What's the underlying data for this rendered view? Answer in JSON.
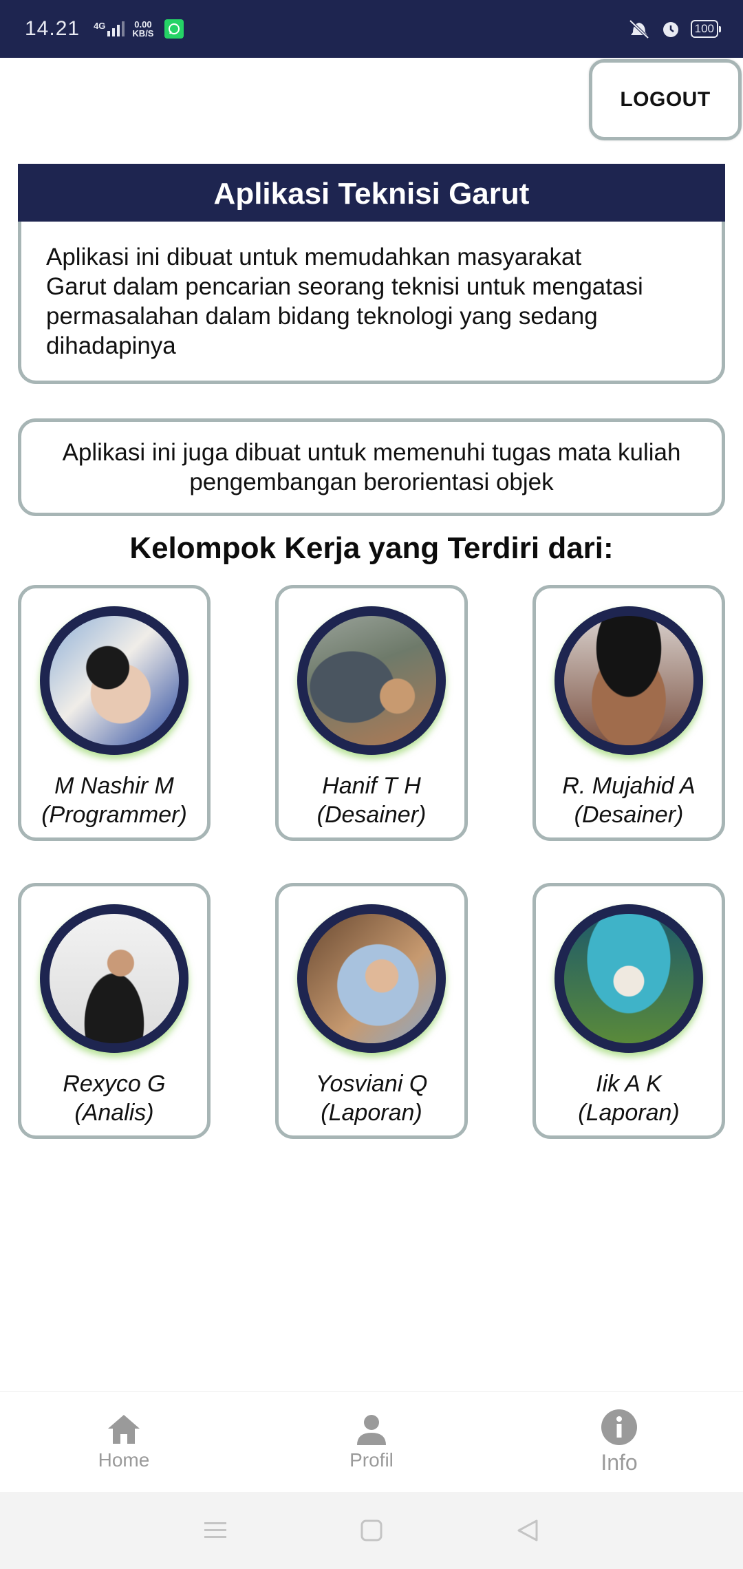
{
  "status_bar": {
    "time": "14.21",
    "network": "4G",
    "speed_value": "0.00",
    "speed_unit": "KB/S",
    "battery": "100"
  },
  "header": {
    "logout_label": "LOGOUT",
    "title": "Aplikasi Teknisi Garut"
  },
  "description": {
    "line1": "Aplikasi ini dibuat untuk memudahkan masyarakat",
    "line2": "Garut dalam pencarian seorang teknisi untuk mengatasi",
    "line3": "permasalahan dalam bidang teknologi yang sedang",
    "line4": "dihadapinya"
  },
  "note": {
    "line1": "Aplikasi ini juga dibuat untuk memenuhi tugas mata kuliah",
    "line2": "pengembangan berorientasi objek"
  },
  "group": {
    "heading": "Kelompok Kerja yang Terdiri dari:",
    "members": [
      {
        "name": "M Nashir M",
        "role": "(Programmer)"
      },
      {
        "name": "Hanif T H",
        "role": "(Desainer)"
      },
      {
        "name": "R. Mujahid A",
        "role": "(Desainer)"
      },
      {
        "name": "Rexyco G",
        "role": "(Analis)"
      },
      {
        "name": "Yosviani Q",
        "role": "(Laporan)"
      },
      {
        "name": "Iik A K",
        "role": "(Laporan)"
      }
    ]
  },
  "bottom_nav": {
    "items": [
      {
        "label": "Home",
        "icon": "home-icon"
      },
      {
        "label": "Profil",
        "icon": "person-icon"
      },
      {
        "label": "Info",
        "icon": "info-icon"
      }
    ]
  },
  "colors": {
    "primary": "#1e2550",
    "card_border": "#a7b5b5",
    "nav_inactive": "#9a9a9a"
  }
}
